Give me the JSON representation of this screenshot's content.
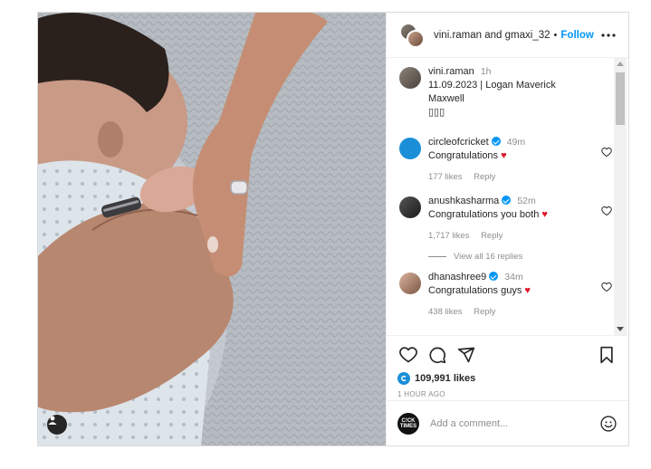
{
  "header": {
    "user1": "vini.raman",
    "and_word": "and",
    "user2": "gmaxi_32",
    "separator": "•",
    "follow_label": "Follow"
  },
  "caption": {
    "username": "vini.raman",
    "time": "1h",
    "text": "11.09.2023 | Logan Maverick Maxwell",
    "emoji_line": "▯▯▯"
  },
  "comments": [
    {
      "username": "circleofcricket",
      "verified": true,
      "time": "49m",
      "text": "Congratulations",
      "heart": "♥",
      "likes": "177 likes",
      "reply": "Reply"
    },
    {
      "username": "anushkasharma",
      "verified": true,
      "time": "52m",
      "text": "Congratulations you both",
      "heart": "♥",
      "likes": "1,717 likes",
      "reply": "Reply",
      "view_replies": "View all 16 replies"
    },
    {
      "username": "dhanashree9",
      "verified": true,
      "time": "34m",
      "text": "Congratulations guys",
      "heart": "♥",
      "likes": "438 likes",
      "reply": "Reply"
    }
  ],
  "footer": {
    "likes_count": "109,991 likes",
    "posted_ago": "1 HOUR AGO",
    "comment_placeholder": "Add a comment...",
    "my_avatar_text": "C!CK TIMES"
  },
  "icons": {
    "like": "heart-icon",
    "comment": "comment-icon",
    "share": "share-icon",
    "save": "bookmark-icon",
    "more": "more-icon",
    "emoji": "emoji-icon",
    "user_tag": "user-icon"
  },
  "colors": {
    "accent": "#0095f6",
    "heart": "#e0162b",
    "muted": "#8e8e8e"
  }
}
